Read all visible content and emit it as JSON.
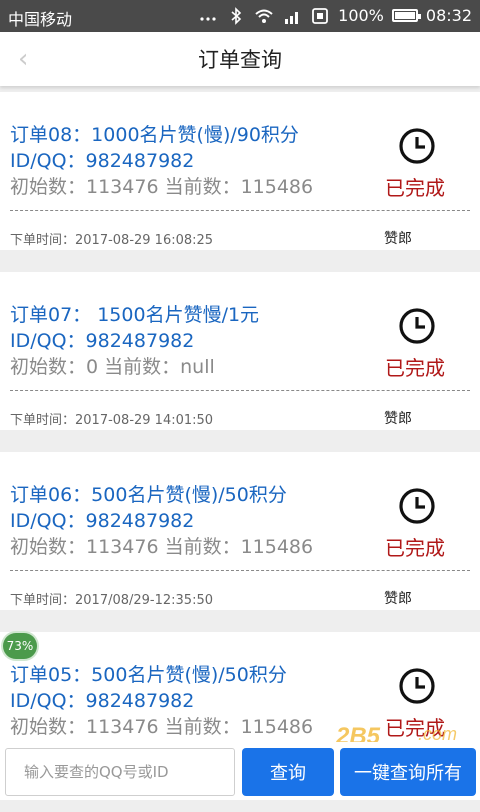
{
  "status_bar": {
    "carrier": "中国移动",
    "battery": "100%",
    "time": "08:32"
  },
  "header": {
    "back_glyph": "‹",
    "title": "订单查询"
  },
  "orders": [
    {
      "title": "订单08：1000名片赞(慢)/90积分",
      "id_line": "ID/QQ：982487982",
      "counts": "初始数：113476 当前数：115486",
      "status": "已完成",
      "time": "下单时间：2017-08-29 16:08:25",
      "source": "赞郎"
    },
    {
      "title": "订单07： 1500名片赞慢/1元",
      "id_line": "ID/QQ：982487982",
      "counts": "初始数：0 当前数：null",
      "status": "已完成",
      "time": "下单时间：2017-08-29 14:01:50",
      "source": "赞郎"
    },
    {
      "title": "订单06：500名片赞(慢)/50积分",
      "id_line": "ID/QQ：982487982",
      "counts": "初始数：113476 当前数：115486",
      "status": "已完成",
      "time": "下单时间：2017/08/29-12:35:50",
      "source": "赞郎"
    },
    {
      "title": "订单05：500名片赞(慢)/50积分",
      "id_line": "ID/QQ：982487982",
      "counts": "初始数：113476 当前数：115486",
      "status": "已完成",
      "time": "",
      "source": ""
    }
  ],
  "search": {
    "placeholder": "输入要查的QQ号或ID",
    "query_label": "查询",
    "query_all_label": "一键查询所有"
  },
  "progress_badge": {
    "label": "73%",
    "value": 73
  },
  "colors": {
    "link_blue": "#1a66c0",
    "done_red": "#b01818",
    "button_blue": "#1a73e8",
    "status_bar": "#4a4a4a"
  }
}
